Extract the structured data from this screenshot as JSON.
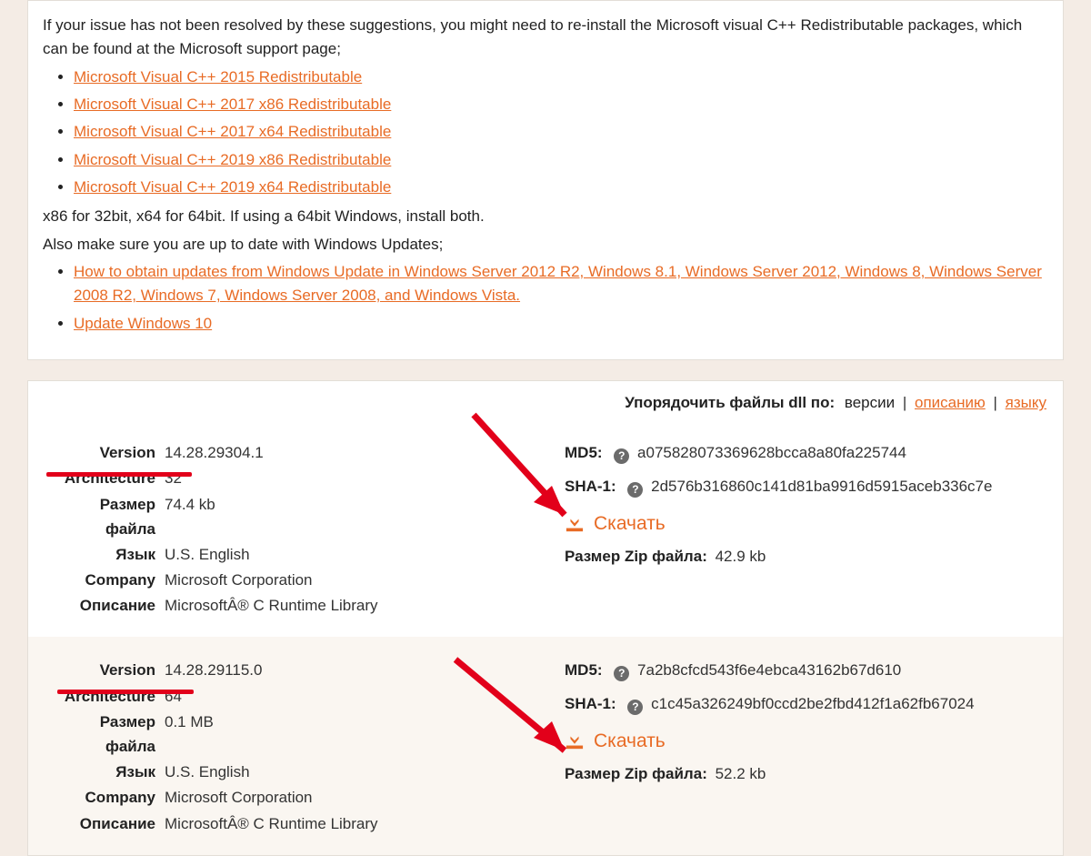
{
  "article": {
    "intro": "If your issue has not been resolved by these suggestions, you might need to re-install the Microsoft visual C++ Redistributable packages, which can be found at the Microsoft support page;",
    "redist_links": [
      "Microsoft Visual C++ 2015 Redistributable",
      "Microsoft Visual C++ 2017 x86 Redistributable",
      "Microsoft Visual C++ 2017 x64 Redistributable",
      "Microsoft Visual C++ 2019 x86 Redistributable",
      "Microsoft Visual C++ 2019 x64 Redistributable"
    ],
    "bitness_note": "x86 for 32bit, x64 for 64bit. If using a 64bit Windows, install both.",
    "updates_note": "Also make sure you are up to date with Windows Updates;",
    "update_links": [
      "How to obtain updates from Windows Update in Windows Server 2012 R2, Windows 8.1, Windows Server 2012, Windows 8, Windows Server 2008 R2, Windows 7, Windows Server 2008, and Windows Vista.",
      "Update Windows 10"
    ]
  },
  "sort": {
    "label": "Упорядочить файлы dll по:",
    "selected": "версии",
    "opt_desc": "описанию",
    "opt_lang": "языку"
  },
  "labels": {
    "version": "Version",
    "arch": "Architecture",
    "filesize": "Размер файла",
    "lang": "Язык",
    "company": "Company",
    "desc": "Описание",
    "md5": "MD5:",
    "sha1": "SHA-1:",
    "download": "Скачать",
    "zipsize": "Размер Zip файла:"
  },
  "files": [
    {
      "version": "14.28.29304.1",
      "arch": "32",
      "filesize": "74.4 kb",
      "lang": "U.S. English",
      "company": "Microsoft Corporation",
      "desc": "MicrosoftÂ® C Runtime Library",
      "md5": "a075828073369628bcca8a80fa225744",
      "sha1": "2d576b316860c141d81ba9916d5915aceb336c7e",
      "zip": "42.9 kb"
    },
    {
      "version": "14.28.29115.0",
      "arch": "64",
      "filesize": "0.1 MB",
      "lang": "U.S. English",
      "company": "Microsoft Corporation",
      "desc": "MicrosoftÂ® C Runtime Library",
      "md5": "7a2b8cfcd543f6e4ebca43162b67d610",
      "sha1": "c1c45a326249bf0ccd2be2fbd412f1a62fb67024",
      "zip": "52.2 kb"
    }
  ]
}
